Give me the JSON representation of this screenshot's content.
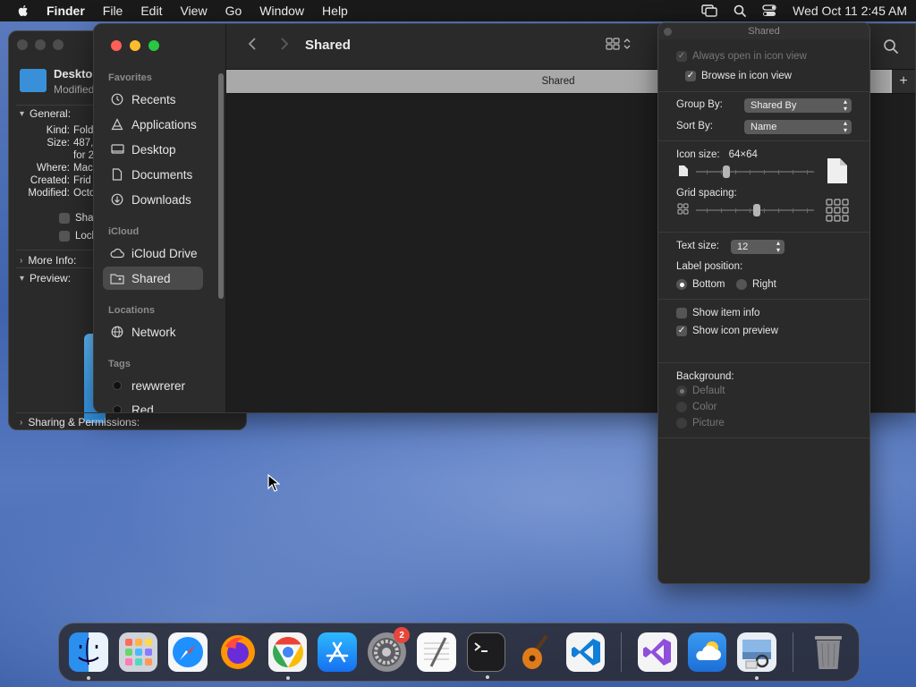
{
  "menubar": {
    "app_name": "Finder",
    "items": [
      "File",
      "Edit",
      "View",
      "Go",
      "Window",
      "Help"
    ],
    "clock": "Wed Oct 11  2:45 AM"
  },
  "info_window": {
    "name": "Deskto",
    "subtitle": "Modified",
    "general_label": "General:",
    "rows": [
      {
        "label": "Kind:",
        "value": "Fold"
      },
      {
        "label": "Size:",
        "value": "487,"
      },
      {
        "label": "",
        "value": "for 2"
      },
      {
        "label": "Where:",
        "value": "Mac"
      },
      {
        "label": "Created:",
        "value": "Frid"
      },
      {
        "label": "Modified:",
        "value": "Octo"
      }
    ],
    "checkboxes": [
      "Shar",
      "Lock"
    ],
    "more_info_label": "More Info:",
    "preview_label": "Preview:",
    "sharing_label": "Sharing & Permissions:"
  },
  "finder": {
    "title": "Shared",
    "tab_label": "Shared",
    "sidebar": {
      "favorites_label": "Favorites",
      "favorites": [
        {
          "label": "Recents",
          "icon": "clock-icon"
        },
        {
          "label": "Applications",
          "icon": "applications-icon"
        },
        {
          "label": "Desktop",
          "icon": "desktop-icon"
        },
        {
          "label": "Documents",
          "icon": "document-icon"
        },
        {
          "label": "Downloads",
          "icon": "download-icon"
        }
      ],
      "icloud_label": "iCloud",
      "icloud": [
        {
          "label": "iCloud Drive",
          "icon": "cloud-icon"
        },
        {
          "label": "Shared",
          "icon": "shared-folder-icon",
          "selected": true
        }
      ],
      "locations_label": "Locations",
      "locations": [
        {
          "label": "Network",
          "icon": "globe-icon"
        }
      ],
      "tags_label": "Tags",
      "tags": [
        {
          "label": "rewwrerer"
        },
        {
          "label": "Red"
        }
      ]
    }
  },
  "view_options": {
    "title": "Shared",
    "always_open_icon_view": "Always open in icon view",
    "browse_icon_view": "Browse in icon view",
    "group_by_label": "Group By:",
    "group_by_value": "Shared By",
    "sort_by_label": "Sort By:",
    "sort_by_value": "Name",
    "icon_size_label": "Icon size:",
    "icon_size_value": "64×64",
    "icon_size_fraction": 0.24,
    "grid_spacing_label": "Grid spacing:",
    "grid_spacing_fraction": 0.52,
    "text_size_label": "Text size:",
    "text_size_value": "12",
    "label_position_label": "Label position:",
    "label_position_options": [
      "Bottom",
      "Right"
    ],
    "label_position_selected": "Bottom",
    "show_item_info": "Show item info",
    "show_icon_preview": "Show icon preview",
    "background_label": "Background:",
    "background_options": [
      "Default",
      "Color",
      "Picture"
    ],
    "background_selected": "Default"
  },
  "dock": {
    "apps": [
      {
        "name": "finder-icon"
      },
      {
        "name": "launchpad-icon"
      },
      {
        "name": "safari-icon"
      },
      {
        "name": "firefox-icon"
      },
      {
        "name": "chrome-icon"
      },
      {
        "name": "app-store-icon"
      },
      {
        "name": "system-settings-icon",
        "badge": "2"
      },
      {
        "name": "textedit-icon"
      },
      {
        "name": "terminal-icon"
      },
      {
        "name": "garageband-icon"
      },
      {
        "name": "vscode-icon"
      },
      {
        "name": "visual-studio-icon"
      },
      {
        "name": "weather-icon"
      },
      {
        "name": "preview-icon"
      },
      {
        "name": "trash-icon"
      }
    ]
  }
}
